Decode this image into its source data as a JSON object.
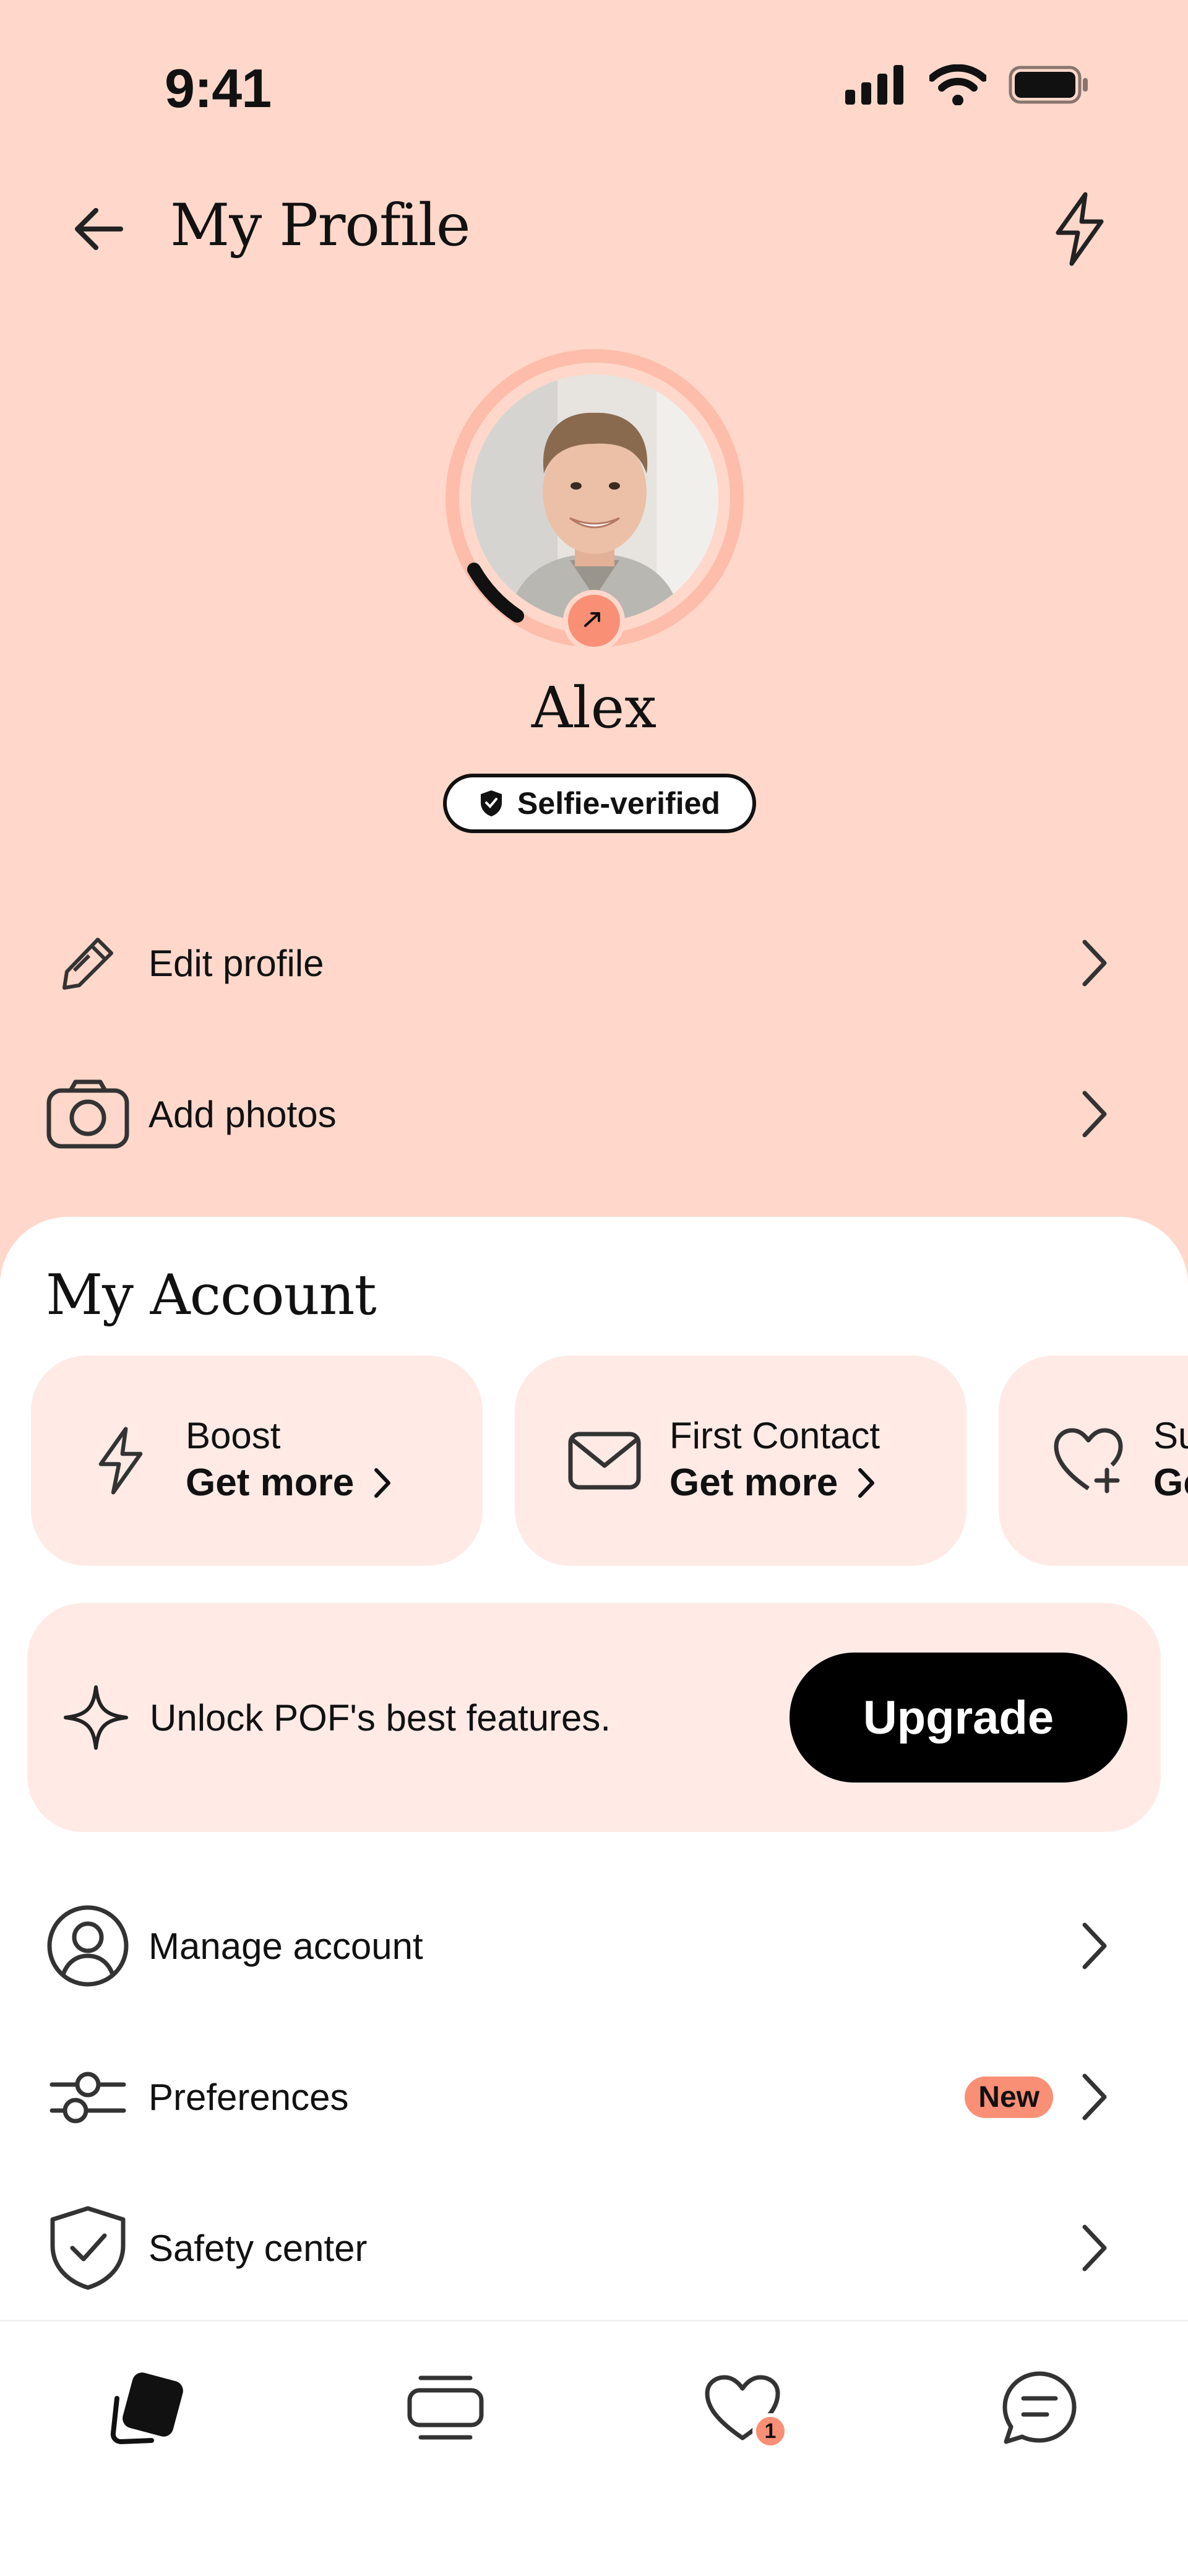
{
  "status_bar": {
    "time": "9:41"
  },
  "header": {
    "title": "My Profile"
  },
  "profile": {
    "name": "Alex",
    "verification": "Selfie-verified"
  },
  "profile_actions": [
    {
      "label": "Edit profile",
      "icon": "pencil-icon"
    },
    {
      "label": "Add photos",
      "icon": "camera-icon"
    }
  ],
  "account": {
    "title": "My Account",
    "cards": [
      {
        "title": "Boost",
        "cta": "Get more",
        "icon": "lightning-icon"
      },
      {
        "title": "First Contact",
        "cta": "Get more",
        "icon": "envelope-icon"
      },
      {
        "title": "Su",
        "cta": "Ge",
        "icon": "heart-plus-icon"
      }
    ],
    "upgrade": {
      "text": "Unlock POF's best features.",
      "button": "Upgrade"
    },
    "menu": [
      {
        "label": "Manage account",
        "icon": "user-circle-icon"
      },
      {
        "label": "Preferences",
        "icon": "sliders-icon",
        "badge": "New"
      },
      {
        "label": "Safety center",
        "icon": "shield-check-icon"
      }
    ]
  },
  "bottom_nav": {
    "items": [
      "cards-icon",
      "feed-icon",
      "heart-icon",
      "chat-icon"
    ],
    "likes_count": "1"
  },
  "colors": {
    "header_bg": "#FFD8CB",
    "card_bg": "#FFEAE6",
    "accent": "#F98F75",
    "primary_button": "#000000"
  }
}
